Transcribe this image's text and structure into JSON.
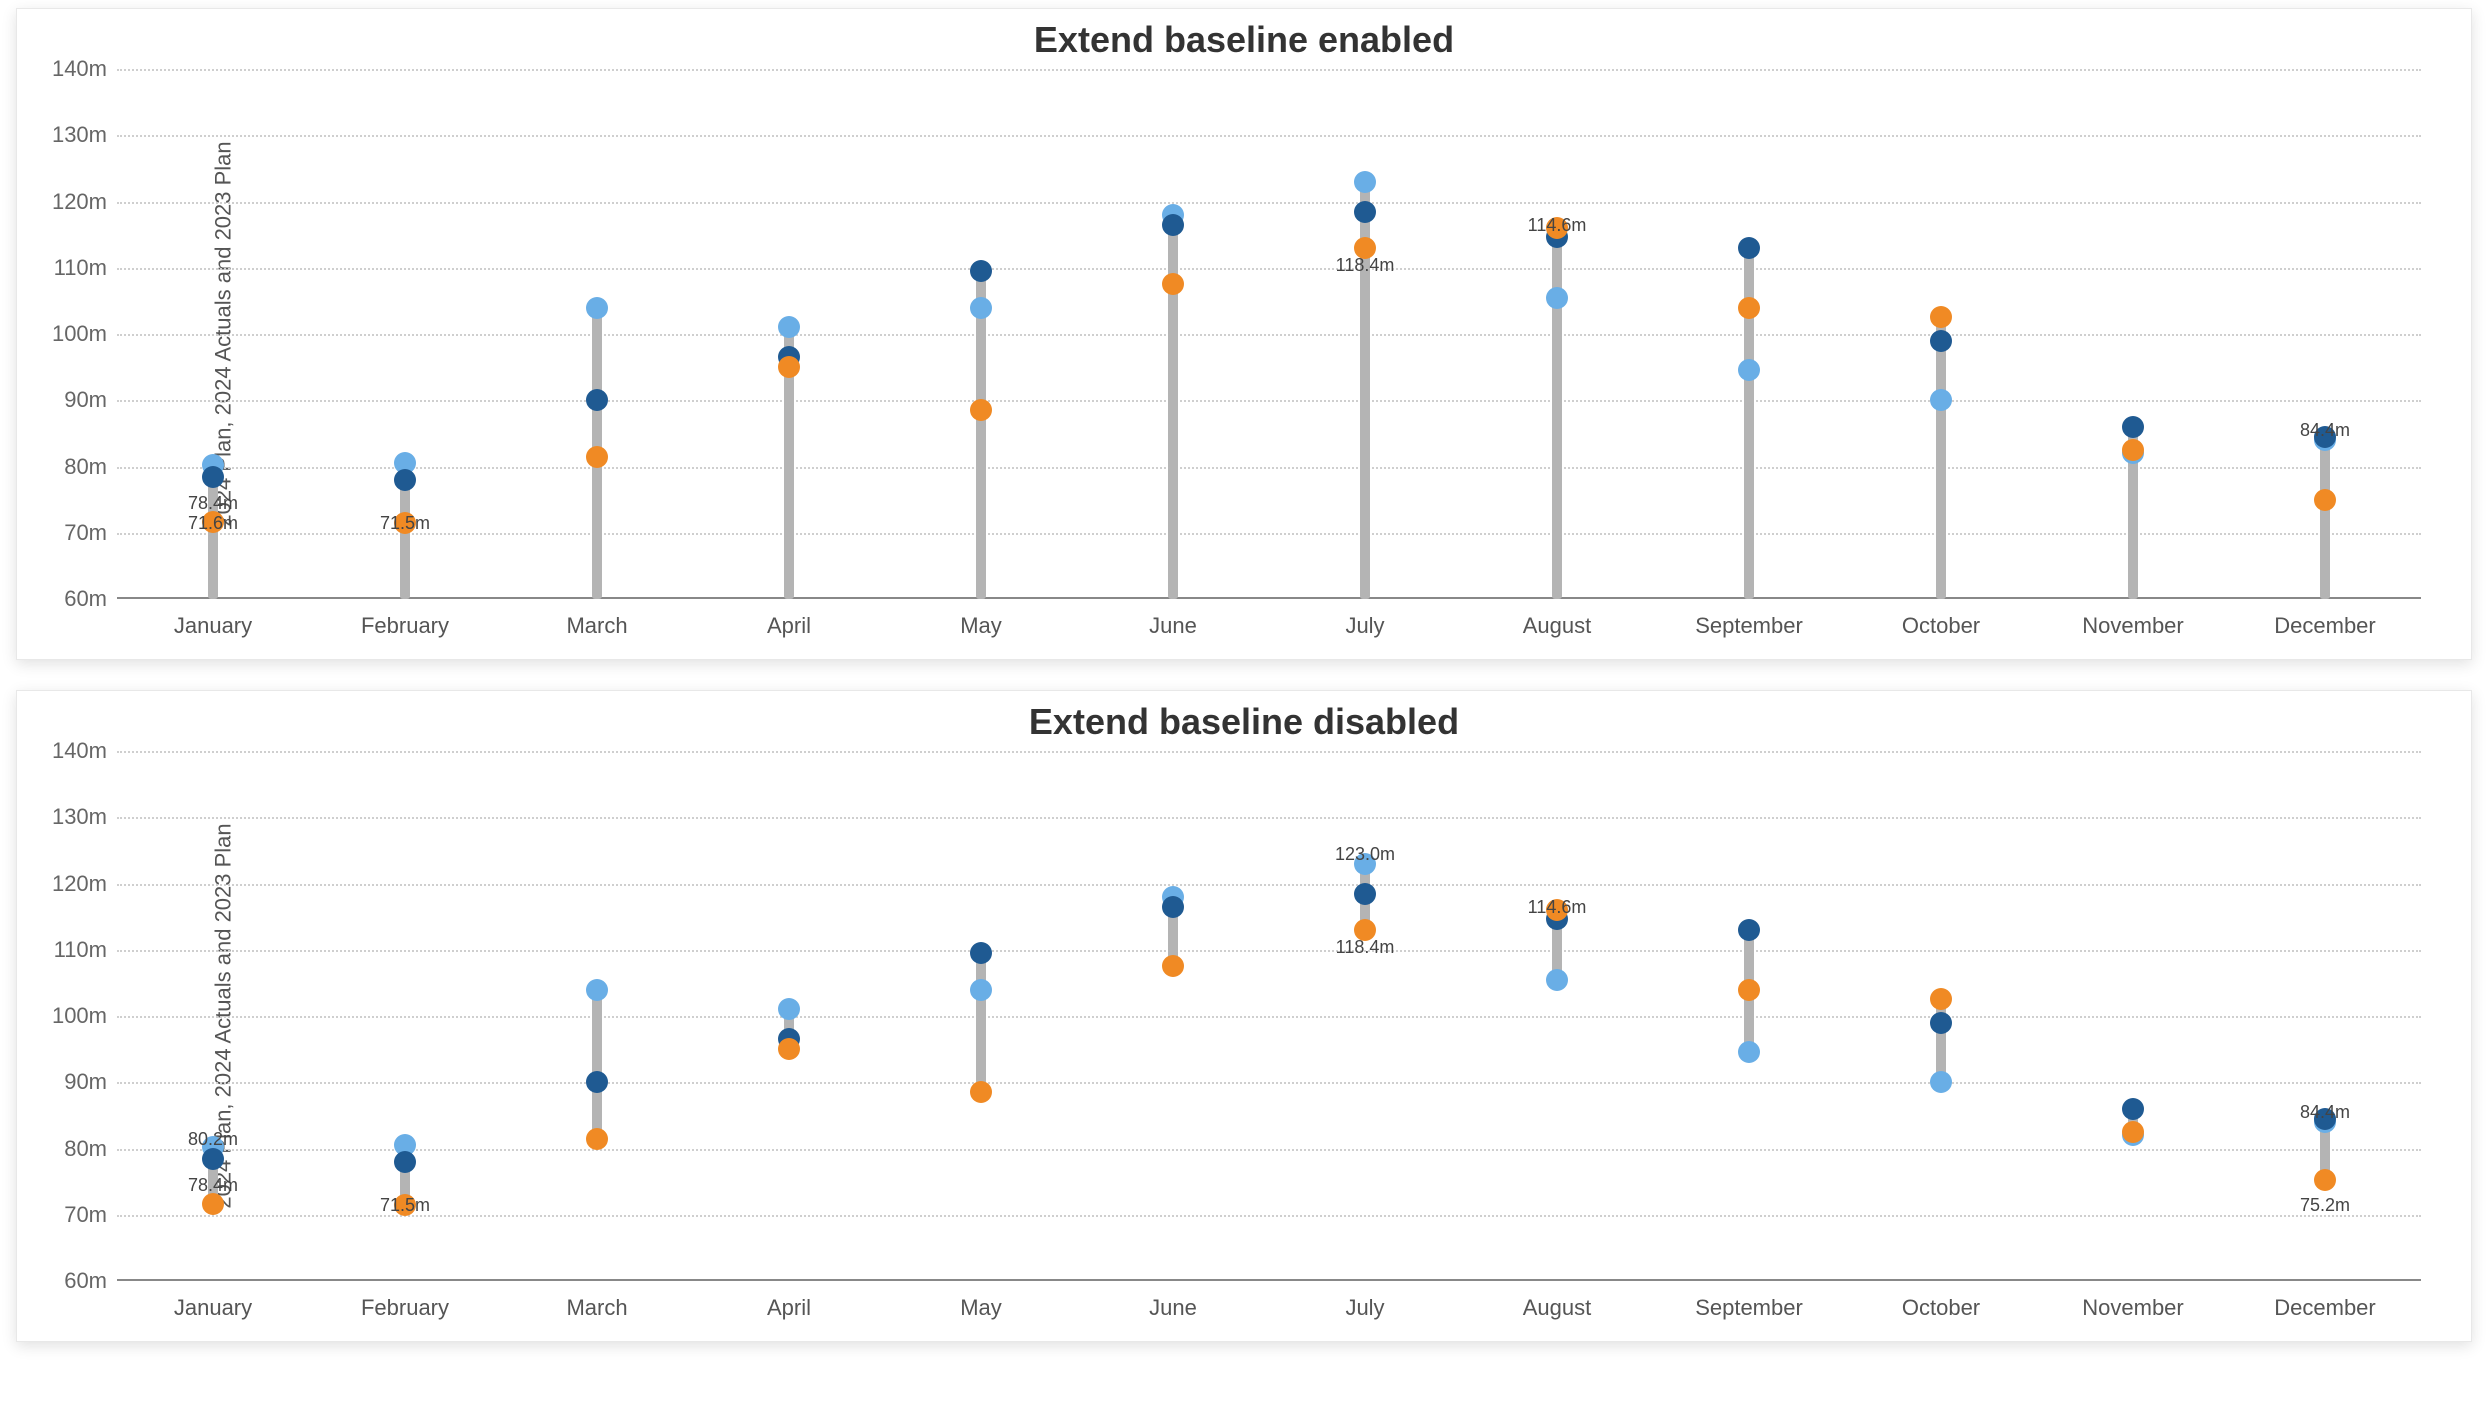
{
  "chart_data": [
    {
      "type": "lollipop",
      "title": "Extend baseline enabled",
      "ylabel": "2024 Plan, 2024 Actuals and 2023 Plan",
      "ylim": [
        60,
        140
      ],
      "y_ticks": [
        60,
        70,
        80,
        90,
        100,
        110,
        120,
        130,
        140
      ],
      "y_tick_labels": [
        "60m",
        "70m",
        "80m",
        "90m",
        "100m",
        "110m",
        "120m",
        "130m",
        "140m"
      ],
      "categories": [
        "January",
        "February",
        "March",
        "April",
        "May",
        "June",
        "July",
        "August",
        "September",
        "October",
        "November",
        "December"
      ],
      "stem_from": 60,
      "series": [
        {
          "name": "2024 Plan",
          "color": "#1f5a92",
          "values": [
            78.4,
            78.0,
            90.0,
            96.5,
            109.5,
            116.5,
            118.4,
            114.6,
            113.0,
            99.0,
            86.0,
            84.4
          ]
        },
        {
          "name": "2024 Actuals",
          "color": "#69aee6",
          "values": [
            80.2,
            80.5,
            104.0,
            101.0,
            104.0,
            118.0,
            123.0,
            105.5,
            94.5,
            90.0,
            82.0,
            84.0
          ]
        },
        {
          "name": "2023 Plan",
          "color": "#f08a24",
          "values": [
            71.6,
            71.5,
            81.5,
            95.0,
            88.5,
            107.5,
            113.0,
            116.0,
            104.0,
            102.5,
            82.5,
            75.0
          ]
        }
      ],
      "annotations": [
        {
          "category": "January",
          "text": "71.6m",
          "y": 73,
          "align": "above"
        },
        {
          "category": "January",
          "text": "78.4m",
          "y": 76,
          "align": "below"
        },
        {
          "category": "February",
          "text": "71.5m",
          "y": 73,
          "align": "above"
        },
        {
          "category": "July",
          "text": "118.4m",
          "y": 112,
          "align": "below"
        },
        {
          "category": "August",
          "text": "114.6m",
          "y": 118,
          "align": "above"
        },
        {
          "category": "December",
          "text": "84.4m",
          "y": 87,
          "align": "above"
        }
      ]
    },
    {
      "type": "lollipop",
      "title": "Extend baseline disabled",
      "ylabel": "2024 Plan, 2024 Actuals and 2023 Plan",
      "ylim": [
        60,
        140
      ],
      "y_ticks": [
        60,
        70,
        80,
        90,
        100,
        110,
        120,
        130,
        140
      ],
      "y_tick_labels": [
        "60m",
        "70m",
        "80m",
        "90m",
        "100m",
        "110m",
        "120m",
        "130m",
        "140m"
      ],
      "categories": [
        "January",
        "February",
        "March",
        "April",
        "May",
        "June",
        "July",
        "August",
        "September",
        "October",
        "November",
        "December"
      ],
      "stem_from": "min_series",
      "series": [
        {
          "name": "2024 Plan",
          "color": "#1f5a92",
          "values": [
            78.4,
            78.0,
            90.0,
            96.5,
            109.5,
            116.5,
            118.4,
            114.6,
            113.0,
            99.0,
            86.0,
            84.4
          ]
        },
        {
          "name": "2024 Actuals",
          "color": "#69aee6",
          "values": [
            80.2,
            80.5,
            104.0,
            101.0,
            104.0,
            118.0,
            123.0,
            105.5,
            94.5,
            90.0,
            82.0,
            84.0
          ]
        },
        {
          "name": "2023 Plan",
          "color": "#f08a24",
          "values": [
            71.6,
            71.5,
            81.5,
            95.0,
            88.5,
            107.5,
            113.0,
            116.0,
            104.0,
            102.5,
            82.5,
            75.2
          ]
        }
      ],
      "annotations": [
        {
          "category": "January",
          "text": "80.2m",
          "y": 83,
          "align": "above"
        },
        {
          "category": "January",
          "text": "78.4m",
          "y": 76,
          "align": "below"
        },
        {
          "category": "February",
          "text": "71.5m",
          "y": 73,
          "align": "above"
        },
        {
          "category": "July",
          "text": "123.0m",
          "y": 126,
          "align": "above"
        },
        {
          "category": "July",
          "text": "118.4m",
          "y": 112,
          "align": "below"
        },
        {
          "category": "August",
          "text": "114.6m",
          "y": 118,
          "align": "above"
        },
        {
          "category": "December",
          "text": "84.4m",
          "y": 87,
          "align": "above"
        },
        {
          "category": "December",
          "text": "75.2m",
          "y": 73,
          "align": "below"
        }
      ]
    }
  ]
}
